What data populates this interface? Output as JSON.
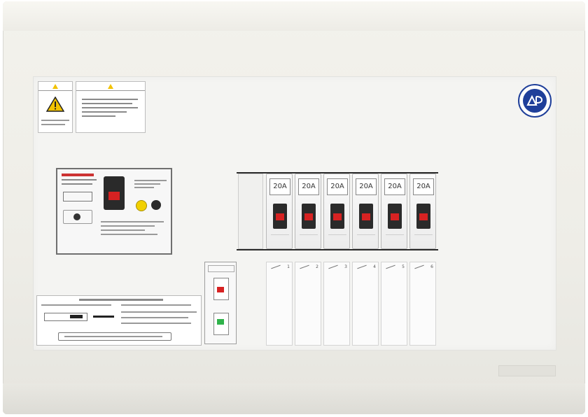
{
  "breakers": [
    {
      "rating": "20A"
    },
    {
      "rating": "20A"
    },
    {
      "rating": "20A"
    },
    {
      "rating": "20A"
    },
    {
      "rating": "20A"
    },
    {
      "rating": "20A"
    }
  ],
  "circuit_numbers": [
    "1",
    "2",
    "3",
    "4",
    "5",
    "6"
  ],
  "colors": {
    "toggle_indicator": "#d72222",
    "test_indicator": "#2fb34a",
    "caution_triangle": "#f2c200",
    "seal_blue": "#1f3f9a",
    "main_button_yellow": "#f2d000"
  },
  "icons": [
    "warning-triangle-icon",
    "certification-seal-icon"
  ]
}
